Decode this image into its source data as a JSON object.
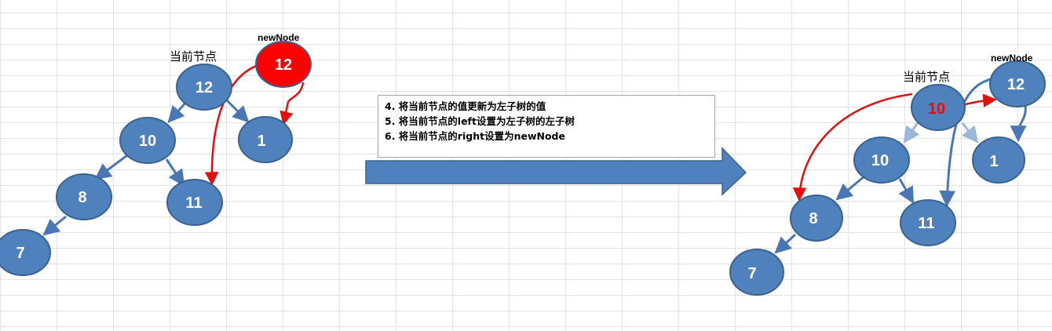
{
  "before": {
    "current_label": "当前节点",
    "new_node_label": "newNode",
    "nodes": {
      "root": "12",
      "left": "10",
      "right": "1",
      "left_left": "8",
      "left_right": "11",
      "left_left_left": "7",
      "new_node": "12"
    }
  },
  "after": {
    "current_label": "当前节点",
    "new_node_label": "newNode",
    "nodes": {
      "root": "10",
      "left": "10",
      "right": "1",
      "left_left": "8",
      "left_right": "11",
      "left_left_left": "7",
      "new_node": "12"
    }
  },
  "steps": [
    "4. 将当前节点的值更新为左子树的值",
    "5. 将当前节点的left设置为左子树的左子树",
    "6. 将当前节点的right设置为newNode"
  ],
  "colors": {
    "node_fill": "#4f81bd",
    "node_stroke": "#3a6291",
    "highlight_node": "#ff0000",
    "edge": "#4a76b4",
    "faded_edge": "#9db7d9",
    "red_arrow": "#e01010",
    "root_text_after": "#e01010",
    "big_arrow": "#4f81bd"
  }
}
